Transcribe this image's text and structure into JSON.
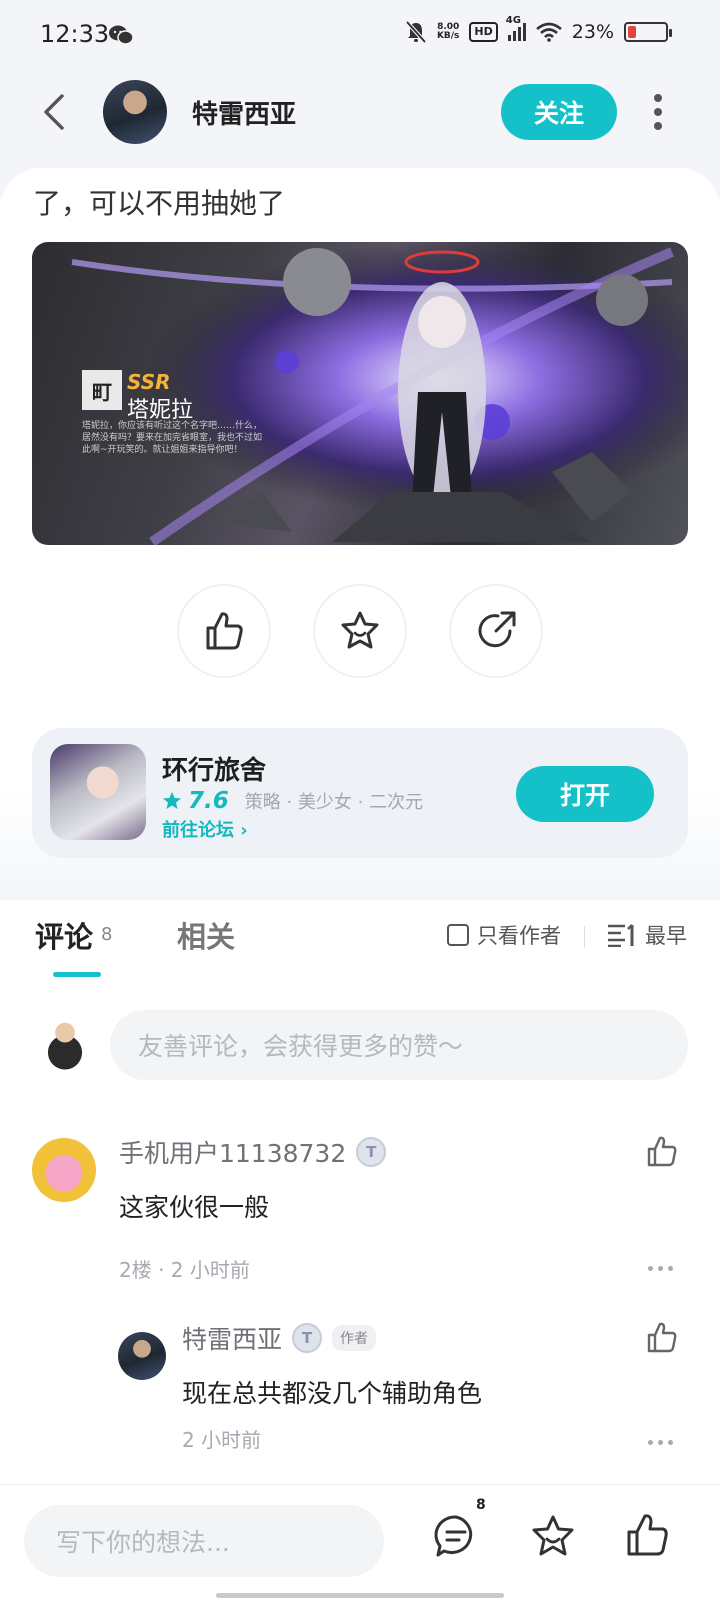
{
  "status_bar": {
    "time": "12:33",
    "net_speed_value": "8.00",
    "net_speed_unit": "KB/s",
    "hd": "HD",
    "signal": "4G",
    "battery_percent": "23%",
    "battery_level": 0.23,
    "icons": [
      "wechat-icon",
      "mute-icon",
      "hd-icon",
      "signal-icon",
      "wifi-icon",
      "battery-icon"
    ]
  },
  "header": {
    "author_name": "特雷西亚",
    "follow_label": "关注"
  },
  "post": {
    "text": "了，可以不用抽她了",
    "image": {
      "rarity": "SSR",
      "badge": "町",
      "character_name": "塔妮拉",
      "description": "塔妮拉，你应该有听过这个名字吧……什么，居然没有吗？要来在加完省眼室，我也不过如此啊~开玩笑的。就让姐姐来指导你吧！"
    },
    "actions": [
      "like-icon",
      "favorite-icon",
      "share-icon"
    ]
  },
  "game_card": {
    "name": "环行旅舍",
    "score": "7.6",
    "tags": "策略 · 美少女 · 二次元",
    "forum_link": "前往论坛",
    "open_label": "打开"
  },
  "comments_section": {
    "tab_comments": "评论",
    "comment_count": "8",
    "tab_related": "相关",
    "only_author": "只看作者",
    "sort_label": "最早",
    "input_placeholder": "友善评论，会获得更多的赞～",
    "comments": [
      {
        "user": "手机用户11138732",
        "level": "T",
        "text": "这家伙很一般",
        "meta": "2楼 · 2 小时前"
      }
    ],
    "reply": {
      "user": "特雷西亚",
      "level": "T",
      "author_tag": "作者",
      "text": "现在总共都没几个辅助角色",
      "meta": "2 小时前"
    }
  },
  "bottom_bar": {
    "placeholder": "写下你的想法...",
    "comment_count": "8"
  },
  "colors": {
    "accent": "#15c1c9",
    "background": "#f3f5f8",
    "battery_low": "#e0463c"
  }
}
